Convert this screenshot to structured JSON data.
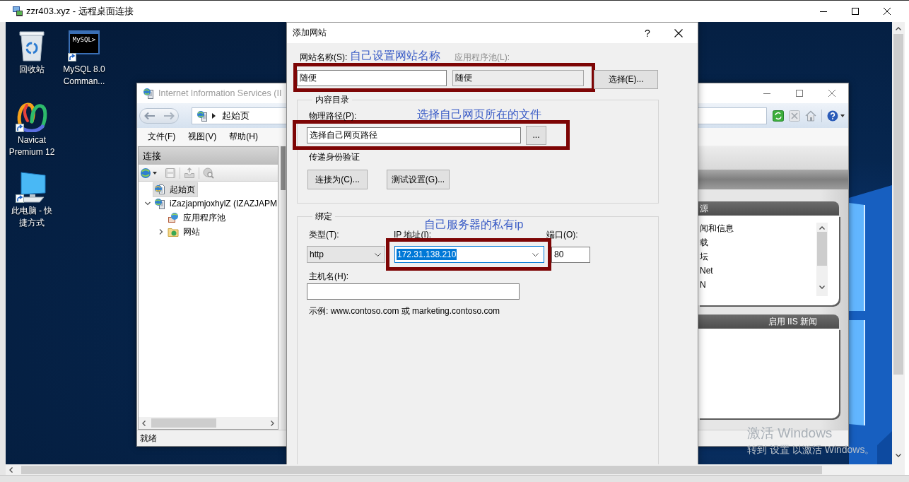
{
  "window": {
    "title": "zzr403.xyz - 远程桌面连接"
  },
  "desktop": {
    "icons": [
      {
        "kind": "recycle-bin",
        "label": "回收站",
        "shortcut": false
      },
      {
        "kind": "console",
        "label": "MySQL 8.0 Comman...",
        "icon_text": "MySQL>",
        "shortcut": true
      },
      {
        "kind": "loops",
        "label": "Navicat Premium 12",
        "shortcut": true
      },
      {
        "kind": "computer",
        "label": "此电脑 - 快捷方式",
        "shortcut": true
      }
    ],
    "activation": {
      "title": "激活 Windows",
      "hint": "转到 设置 以激活 Windows。"
    }
  },
  "iis": {
    "title": "Internet Information Services (II",
    "address": "起始页",
    "menu": [
      "文件(F)",
      "视图(V)",
      "帮助(H)"
    ],
    "connections": {
      "title": "连接",
      "tree": [
        {
          "kind": "start-page",
          "label": "起始页",
          "selected": true
        },
        {
          "kind": "server",
          "label": "iZazjapmjoxhylZ (IZAZJAPM",
          "selected": false,
          "expanded": true,
          "children": [
            {
              "kind": "app-pools",
              "label": "应用程序池",
              "selected": false
            },
            {
              "kind": "sites",
              "label": "网站",
              "selected": false,
              "expanded": false
            }
          ]
        }
      ]
    },
    "start_page": {
      "resources_title": "源",
      "resources": [
        "闻和信息",
        "载",
        "坛",
        "Net",
        "N"
      ],
      "news_title": "启用 IIS 新闻"
    },
    "status": "就绪"
  },
  "dialog": {
    "title": "添加网站",
    "help": "?",
    "site_name": {
      "label": "网站名称(S):",
      "value": "随便",
      "note": "自己设置网站名称"
    },
    "app_pool": {
      "label": "应用程序池(L):",
      "value": "随便",
      "disabled": true
    },
    "select_button": "选择(E)...",
    "content_directory": {
      "title": "内容目录",
      "path_label": "物理路径(P):",
      "path_value": "选择自己网页路径",
      "note": "选择自己网页所在的文件",
      "browse_button": "...",
      "auth_label": "传递身份验证",
      "buttons": [
        "连接为(C)...",
        "测试设置(G)..."
      ]
    },
    "binding": {
      "title": "绑定",
      "note": "自己服务器的私有ip",
      "type": {
        "label": "类型(T):",
        "value": "http"
      },
      "ip": {
        "label": "IP 地址(I):",
        "value": "172.31.138.210",
        "highlighted": true
      },
      "port": {
        "label": "端口(O):",
        "value": "80"
      },
      "host": {
        "label": "主机名(H):"
      },
      "example": "示例: www.contoso.com 或 marketing.contoso.com"
    }
  }
}
